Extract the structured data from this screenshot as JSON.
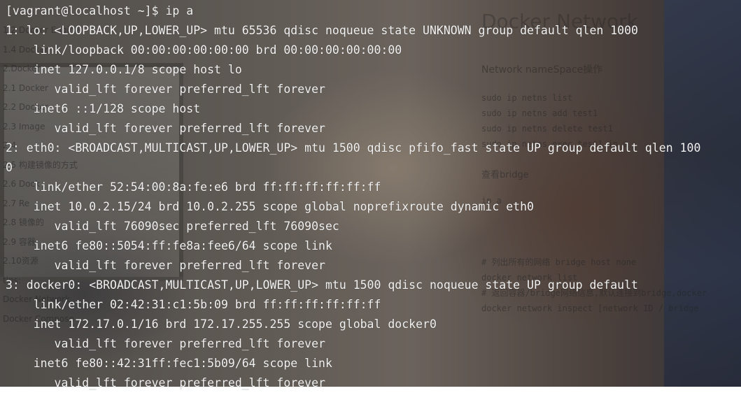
{
  "editor": {
    "heading": "Docker Network",
    "subheading": "Network nameSpace操作",
    "netns_commands": [
      "sudo ip netns list",
      "sudo ip netns add test1",
      "sudo ip netns delete test1",
      "sudo ip netns exec test1 ip a"
    ],
    "bridge_heading": "查看bridge",
    "bridge_cmd": "ip a",
    "network_lines": [
      "# 列出所有的网络 bridge host none",
      "docker network list",
      "# 返回容器/bridge网络信息,默认连接到bridge,docker",
      "docker network inspect [network ID / bridge"
    ],
    "toc": [
      "1.2 Docker Engine",
      "1.4 Docker",
      "2.Docker",
      "2.1 Docker",
      "2.2 Docker",
      "2.3 Image",
      "2.4 ",
      "2.5 构建镜像的方式",
      "2.6 Dock",
      "2.7 Re",
      "2.8 镜像的",
      "2.9 容器",
      "2.10资源",
      "tips:",
      "Docker Network",
      "Docker Compose"
    ]
  },
  "terminal": {
    "lines": [
      "[vagrant@localhost ~]$ ip a",
      "1: lo: <LOOPBACK,UP,LOWER_UP> mtu 65536 qdisc noqueue state UNKNOWN group default qlen 1000",
      "    link/loopback 00:00:00:00:00:00 brd 00:00:00:00:00:00",
      "    inet 127.0.0.1/8 scope host lo",
      "       valid_lft forever preferred_lft forever",
      "    inet6 ::1/128 scope host",
      "       valid_lft forever preferred_lft forever",
      "2: eth0: <BROADCAST,MULTICAST,UP,LOWER_UP> mtu 1500 qdisc pfifo_fast state UP group default qlen 100",
      "0",
      "    link/ether 52:54:00:8a:fe:e6 brd ff:ff:ff:ff:ff:ff",
      "    inet 10.0.2.15/24 brd 10.0.2.255 scope global noprefixroute dynamic eth0",
      "       valid_lft 76090sec preferred_lft 76090sec",
      "    inet6 fe80::5054:ff:fe8a:fee6/64 scope link",
      "       valid_lft forever preferred_lft forever",
      "3: docker0: <BROADCAST,MULTICAST,UP,LOWER_UP> mtu 1500 qdisc noqueue state UP group default",
      "    link/ether 02:42:31:c1:5b:09 brd ff:ff:ff:ff:ff:ff",
      "    inet 172.17.0.1/16 brd 172.17.255.255 scope global docker0",
      "       valid_lft forever preferred_lft forever",
      "    inet6 fe80::42:31ff:fec1:5b09/64 scope link",
      "       valid_lft forever preferred_lft forever"
    ]
  }
}
